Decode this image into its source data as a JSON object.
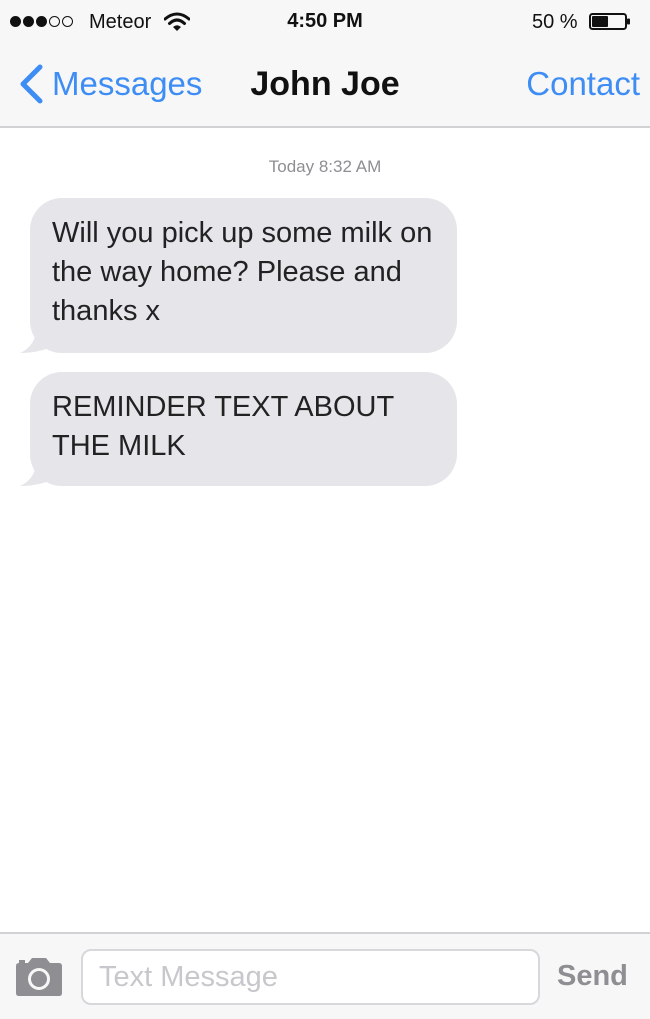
{
  "status_bar": {
    "carrier": "Meteor",
    "time": "4:50 PM",
    "battery_percent": "50 %",
    "battery_level": 0.5,
    "signal_bars_filled": 3,
    "signal_bars_total": 5,
    "icons": [
      "signal-dots-icon",
      "wifi-icon",
      "battery-icon"
    ]
  },
  "nav": {
    "back_label": "Messages",
    "title": "John Joe",
    "contact_label": "Contact",
    "icons": [
      "chevron-left-icon"
    ]
  },
  "conversation": {
    "timestamp": "Today 8:32 AM",
    "messages": [
      {
        "direction": "incoming",
        "text": "Will you pick up some milk on the way home? Please and thanks x"
      },
      {
        "direction": "incoming",
        "text": "REMINDER TEXT ABOUT THE MILK"
      }
    ]
  },
  "input_bar": {
    "placeholder": "Text Message",
    "value": "",
    "send_label": "Send",
    "icons": [
      "camera-icon"
    ]
  },
  "colors": {
    "accent": "#3d8df5",
    "bubble_incoming": "#e5e5ea",
    "bar_background": "#f7f7f7",
    "muted_text": "#8e8e93"
  }
}
